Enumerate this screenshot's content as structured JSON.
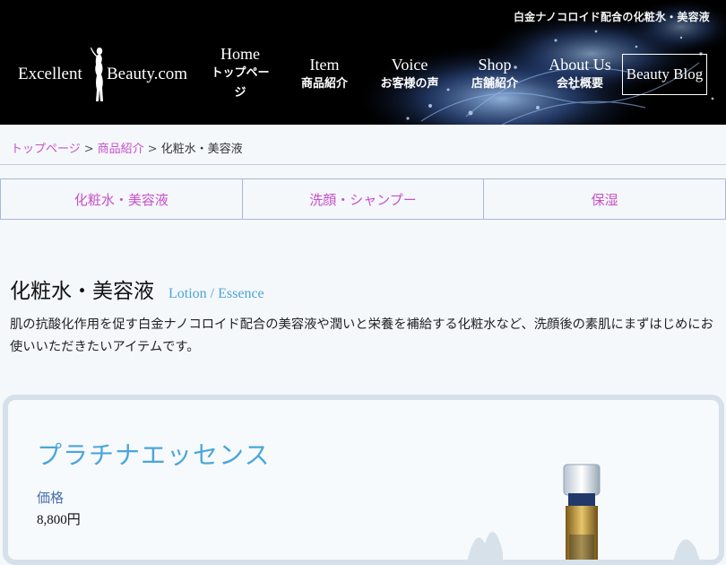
{
  "header": {
    "tagline": "白金ナノコロイド配合の化粧水・美容液",
    "logo": {
      "left": "Excellent",
      "right": "Beauty.com"
    },
    "nav": [
      {
        "en": "Home",
        "ja": "トップペー\nジ"
      },
      {
        "en": "Item",
        "ja": "商品紹介"
      },
      {
        "en": "Voice",
        "ja": "お客様の声"
      },
      {
        "en": "Shop",
        "ja": "店舗紹介"
      },
      {
        "en": "About Us",
        "ja": "会社概要"
      }
    ],
    "blog_label": "Beauty Blog"
  },
  "breadcrumb": {
    "home": "トップページ",
    "items": "商品紹介",
    "current": "化粧水・美容液",
    "separator": ">"
  },
  "category_tabs": [
    "化粧水・美容液",
    "洗顔・シャンプー",
    "保湿"
  ],
  "section": {
    "title_ja": "化粧水・美容液",
    "title_en": "Lotion / Essence",
    "description": "肌の抗酸化作用を促す白金ナノコロイド配合の美容液や潤いと栄養を補給する化粧水など、洗顔後の素肌にまずはじめにお使いいただきたいアイテムです。"
  },
  "product": {
    "name": "プラチナエッセンス",
    "price_label": "価格",
    "price": "8,800円"
  },
  "colors": {
    "header_bg": "#000000",
    "link": "#c94fc9",
    "accent_blue": "#4aa6db",
    "price_label": "#4a6fae",
    "page_bg": "#f4f8fb"
  }
}
